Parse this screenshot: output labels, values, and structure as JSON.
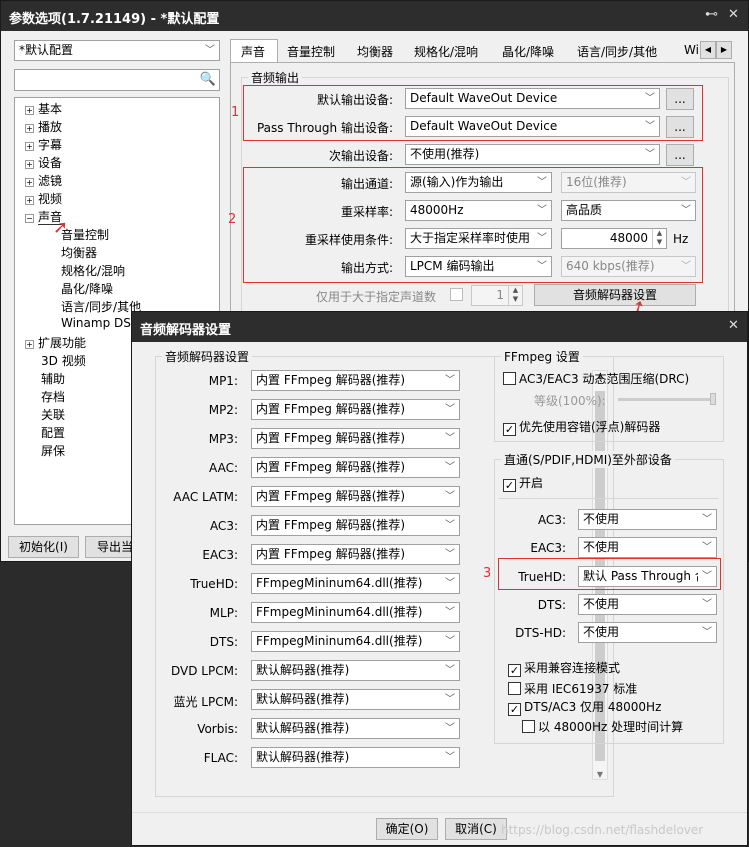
{
  "main": {
    "title": "参数选项(1.7.21149) - *默认配置",
    "pin": "⊷",
    "close": "✕",
    "profile": "*默认配置",
    "tree": [
      "基本",
      "播放",
      "字幕",
      "设备",
      "滤镜",
      "视频",
      "声音",
      "音量控制",
      "均衡器",
      "规格化/混响",
      "晶化/降噪",
      "语言/同步/其他",
      "Winamp DSP",
      "扩展功能",
      "3D 视频",
      "辅助",
      "存档",
      "关联",
      "配置",
      "屏保"
    ],
    "init_btn": "初始化(I)",
    "export_btn": "导出当",
    "tabs": [
      "声音",
      "音量控制",
      "均衡器",
      "规格化/混响",
      "晶化/降噪",
      "语言/同步/其他",
      "Wi"
    ],
    "group": "音频输出",
    "rows": {
      "default_out": "默认输出设备:",
      "default_val": "Default WaveOut Device",
      "pass_out": "Pass Through 输出设备:",
      "pass_val": "Default WaveOut Device",
      "sub_out": "次输出设备:",
      "sub_val": "不使用(推荐)",
      "channel": "输出通道:",
      "channel_val": "源(输入)作为输出",
      "bits_val": "16位(推荐)",
      "rate": "重采样率:",
      "rate_val": "48000Hz",
      "quality_val": "高品质",
      "cond": "重采样使用条件:",
      "cond_val": "大于指定采样率时使用",
      "cond_num": "48000",
      "hz": "Hz",
      "mode": "输出方式:",
      "mode_val": "LPCM 编码输出",
      "kbps_val": "640 kbps(推荐)",
      "only_ch": "仅用于大于指定声道数",
      "only_ch_num": "1",
      "decoder_btn": "音频解码器设置",
      "dots": "..."
    },
    "marks": [
      "1",
      "2"
    ]
  },
  "dlg": {
    "title": "音频解码器设置",
    "close": "✕",
    "group": "音频解码器设置",
    "decoders": [
      {
        "name": "MP1:",
        "val": "内置 FFmpeg 解码器(推荐)"
      },
      {
        "name": "MP2:",
        "val": "内置 FFmpeg 解码器(推荐)"
      },
      {
        "name": "MP3:",
        "val": "内置 FFmpeg 解码器(推荐)"
      },
      {
        "name": "AAC:",
        "val": "内置 FFmpeg 解码器(推荐)"
      },
      {
        "name": "AAC LATM:",
        "val": "内置 FFmpeg 解码器(推荐)"
      },
      {
        "name": "AC3:",
        "val": "内置 FFmpeg 解码器(推荐)"
      },
      {
        "name": "EAC3:",
        "val": "内置 FFmpeg 解码器(推荐)"
      },
      {
        "name": "TrueHD:",
        "val": "FFmpegMininum64.dll(推荐)"
      },
      {
        "name": "MLP:",
        "val": "FFmpegMininum64.dll(推荐)"
      },
      {
        "name": "DTS:",
        "val": "FFmpegMininum64.dll(推荐)"
      },
      {
        "name": "DVD LPCM:",
        "val": "默认解码器(推荐)"
      },
      {
        "name": "蓝光 LPCM:",
        "val": "默认解码器(推荐)"
      },
      {
        "name": "Vorbis:",
        "val": "默认解码器(推荐)"
      },
      {
        "name": "FLAC:",
        "val": "默认解码器(推荐)"
      }
    ],
    "ffmpeg": {
      "title": "FFmpeg 设置",
      "drc": "AC3/EAC3 动态范围压缩(DRC)",
      "level": "等级(100%):",
      "fp": "优先使用容错(浮点)解码器"
    },
    "pass": {
      "title": "直通(S/PDIF,HDMI)至外部设备",
      "enable": "开启",
      "items": [
        {
          "name": "AC3:",
          "val": "不使用"
        },
        {
          "name": "EAC3:",
          "val": "不使用"
        },
        {
          "name": "TrueHD:",
          "val": "默认 Pass Through 合"
        },
        {
          "name": "DTS:",
          "val": "不使用"
        },
        {
          "name": "DTS-HD:",
          "val": "不使用"
        }
      ]
    },
    "opts": {
      "compat": "采用兼容连接模式",
      "iec": "采用 IEC61937 标准",
      "dts48": "DTS/AC3 仅用 48000Hz",
      "calc": "以 48000Hz 处理时间计算"
    },
    "ok": "确定(O)",
    "cancel": "取消(C)",
    "mark": "3"
  },
  "watermark": "https://blog.csdn.net/flashdelover",
  "check": "✓"
}
